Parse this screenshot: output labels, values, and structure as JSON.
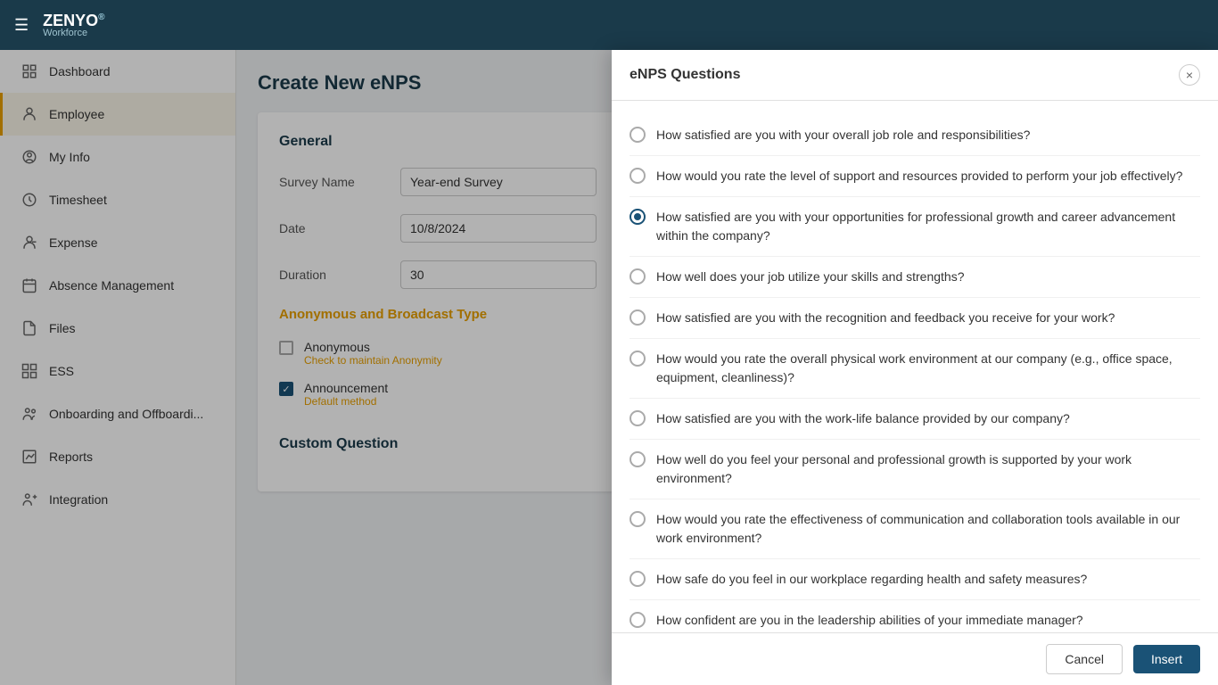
{
  "header": {
    "logo_main": "ZENYO",
    "logo_sub": "Workforce",
    "hamburger_label": "☰"
  },
  "sidebar": {
    "items": [
      {
        "id": "dashboard",
        "label": "Dashboard",
        "icon": "dashboard"
      },
      {
        "id": "employee",
        "label": "Employee",
        "icon": "person"
      },
      {
        "id": "myinfo",
        "label": "My Info",
        "icon": "person-circle"
      },
      {
        "id": "timesheet",
        "label": "Timesheet",
        "icon": "clock"
      },
      {
        "id": "expense",
        "label": "Expense",
        "icon": "person-tag"
      },
      {
        "id": "absence",
        "label": "Absence Management",
        "icon": "calendar"
      },
      {
        "id": "files",
        "label": "Files",
        "icon": "file"
      },
      {
        "id": "ess",
        "label": "ESS",
        "icon": "grid"
      },
      {
        "id": "onboarding",
        "label": "Onboarding and Offboardi...",
        "icon": "people"
      },
      {
        "id": "reports",
        "label": "Reports",
        "icon": "chart"
      },
      {
        "id": "integration",
        "label": "Integration",
        "icon": "link"
      }
    ]
  },
  "page": {
    "title": "Create New eNPS",
    "general_section": "General",
    "survey_name_label": "Survey Name",
    "survey_name_value": "Year-end Survey",
    "date_label": "Date",
    "date_value": "10/8/2024",
    "duration_label": "Duration",
    "duration_value": "30",
    "broadcast_section": "Anonymous and Broadcast Type",
    "anonymous_label": "Anonymous",
    "anonymous_sub": "Check to maintain Anonymity",
    "anonymous_checked": false,
    "announcement_label": "Announcement",
    "announcement_sub": "Default method",
    "announcement_checked": true,
    "custom_section": "Custom Question"
  },
  "modal": {
    "title": "eNPS Questions",
    "close_label": "×",
    "questions": [
      {
        "id": 1,
        "text": "How satisfied are you with your overall job role and responsibilities?",
        "selected": false
      },
      {
        "id": 2,
        "text": "How would you rate the level of support and resources provided to perform your job effectively?",
        "selected": false
      },
      {
        "id": 3,
        "text": "How satisfied are you with your opportunities for professional growth and career advancement within the company?",
        "selected": true
      },
      {
        "id": 4,
        "text": "How well does your job utilize your skills and strengths?",
        "selected": false
      },
      {
        "id": 5,
        "text": "How satisfied are you with the recognition and feedback you receive for your work?",
        "selected": false
      },
      {
        "id": 6,
        "text": "How would you rate the overall physical work environment at our company (e.g., office space, equipment, cleanliness)?",
        "selected": false
      },
      {
        "id": 7,
        "text": "How satisfied are you with the work-life balance provided by our company?",
        "selected": false
      },
      {
        "id": 8,
        "text": "How well do you feel your personal and professional growth is supported by your work environment?",
        "selected": false
      },
      {
        "id": 9,
        "text": "How would you rate the effectiveness of communication and collaboration tools available in our work environment?",
        "selected": false
      },
      {
        "id": 10,
        "text": "How safe do you feel in our workplace regarding health and safety measures?",
        "selected": false
      },
      {
        "id": 11,
        "text": "How confident are you in the leadership abilities of your immediate manager?",
        "selected": false
      }
    ],
    "cancel_label": "Cancel",
    "insert_label": "Insert"
  }
}
